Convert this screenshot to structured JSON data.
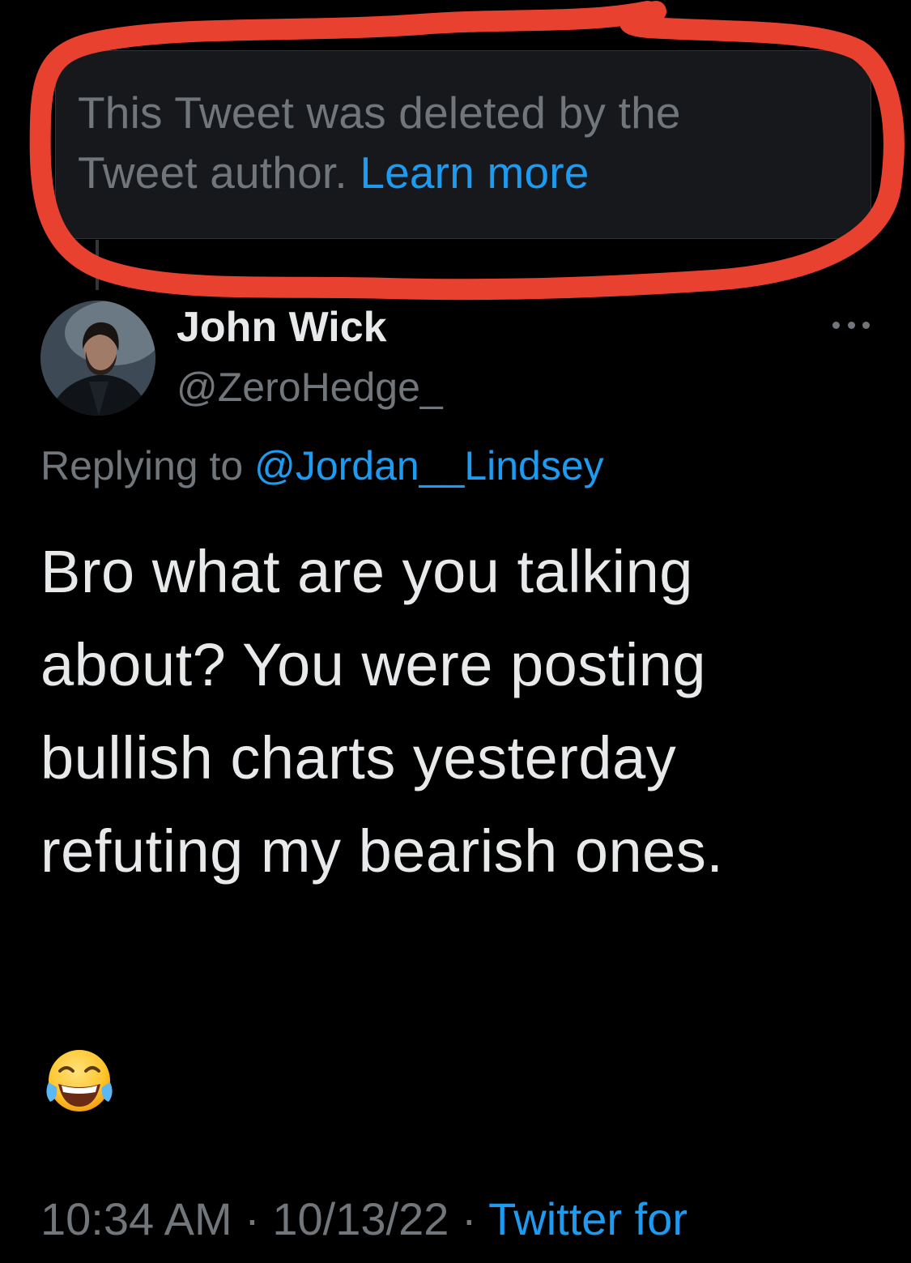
{
  "deleted_notice": {
    "text": "This Tweet was deleted by the Tweet author.",
    "link_label": "Learn more"
  },
  "tweet": {
    "display_name": "John Wick",
    "handle": "@ZeroHedge_",
    "replying_prefix": "Replying to",
    "replying_to": "@Jordan__Lindsey",
    "body": "Bro what are you talking about? You were posting bullish charts yesterday refuting my bearish ones.",
    "emoji": "😂",
    "time": "10:34 AM",
    "separator": "·",
    "date": "10/13/22",
    "source": "Twitter for"
  },
  "icons": {
    "more": "more-options-icon",
    "avatar": "avatar-image"
  },
  "colors": {
    "background": "#000000",
    "card": "#16181c",
    "text_primary": "#e7e9ea",
    "text_secondary": "#71767b",
    "accent": "#1d9bf0",
    "highlight": "#e8412f"
  }
}
